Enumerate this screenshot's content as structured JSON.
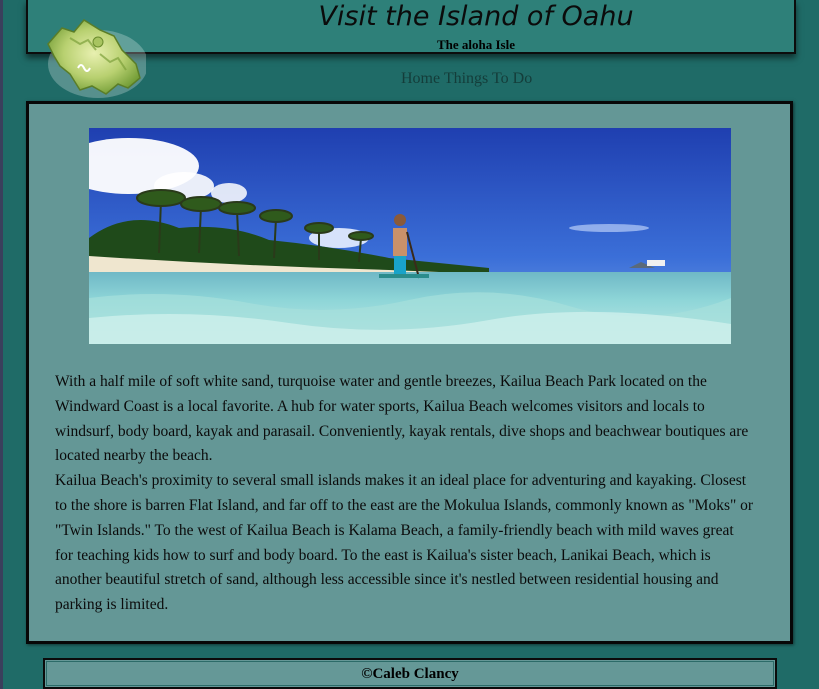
{
  "header": {
    "title": "Visit the Island of Oahu",
    "subtitle": "The aloha Isle",
    "logo_icon": "oahu-island-map-icon"
  },
  "nav": {
    "items": [
      {
        "label": "Home"
      },
      {
        "label": "Things To Do"
      }
    ]
  },
  "main": {
    "hero_image_icon": "paddleboarder-beach-photo",
    "paragraphs": [
      "With a half mile of soft white sand, turquoise water and gentle breezes, Kailua Beach Park located on the Windward Coast is a local favorite. A hub for water sports, Kailua Beach welcomes visitors and locals to windsurf, body board, kayak and parasail. Conveniently, kayak rentals, dive shops and beachwear boutiques are located nearby the beach.",
      "Kailua Beach's proximity to several small islands makes it an ideal place for adventuring and kayaking. Closest to the shore is barren Flat Island, and far off to the east are the Mokulua Islands, commonly known as \"Moks\" or \"Twin Islands.\" To the west of Kailua Beach is Kalama Beach, a family-friendly beach with mild waves great for teaching kids how to surf and body board. To the east is Kailua's sister beach, Lanikai Beach, which is another beautiful stretch of sand, although less accessible since it's nestled between residential housing and parking is limited."
    ]
  },
  "footer": {
    "text": "©Caleb Clancy"
  },
  "colors": {
    "page_bg": "#1f6b67",
    "header_bg": "#2e8079",
    "content_bg": "#649796",
    "text": "#0b0b0b"
  }
}
